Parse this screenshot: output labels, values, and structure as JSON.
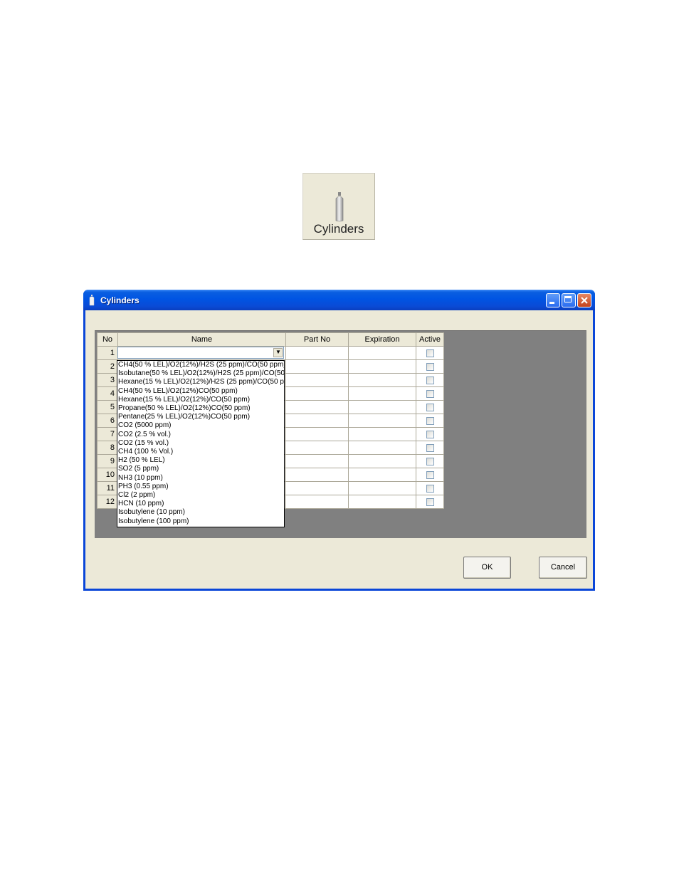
{
  "toolbar_button": {
    "label": "Cylinders",
    "icon": "cylinder-icon"
  },
  "dialog": {
    "title": "Cylinders",
    "icon": "cylinder-icon",
    "window_controls": {
      "minimize": "minimize-icon",
      "maximize": "maximize-icon",
      "close": "close-icon"
    },
    "grid": {
      "columns": [
        "No",
        "Name",
        "Part No",
        "Expiration",
        "Active"
      ],
      "rows": [
        "1",
        "2",
        "3",
        "4",
        "5",
        "6",
        "7",
        "8",
        "9",
        "10",
        "11",
        "12"
      ]
    },
    "name_combo": {
      "value": "",
      "open": true
    },
    "dropdown_options": [
      "CH4(50 % LEL)/O2(12%)/H2S (25 ppm)/CO(50 ppm)",
      "Isobutane(50 % LEL)/O2(12%)/H2S (25 ppm)/CO(50",
      "Hexane(15 % LEL)/O2(12%)/H2S (25 ppm)/CO(50 p",
      "CH4(50 % LEL)/O2(12%)CO(50 ppm)",
      "Hexane(15 % LEL)/O2(12%)/CO(50 ppm)",
      "Propane(50 % LEL)/O2(12%)CO(50 ppm)",
      "Pentane(25 % LEL)/O2(12%)CO(50 ppm)",
      "CO2 (5000 ppm)",
      "CO2 (2.5 % vol.)",
      "CO2 (15 % vol.)",
      "CH4 (100 % Vol.)",
      "H2 (50 % LEL)",
      "SO2 (5 ppm)",
      "NH3 (10 ppm)",
      "PH3 (0.55 ppm)",
      "Cl2 (2 ppm)",
      "HCN (10 ppm)",
      "Isobutylene (10 ppm)",
      "Isobutylene (100 ppm)"
    ],
    "ok_label": "OK",
    "cancel_label": "Cancel"
  },
  "colors": {
    "titlebar": "#0054e3",
    "dialog_bg": "#ece9d8",
    "grid_bg": "#808080"
  }
}
